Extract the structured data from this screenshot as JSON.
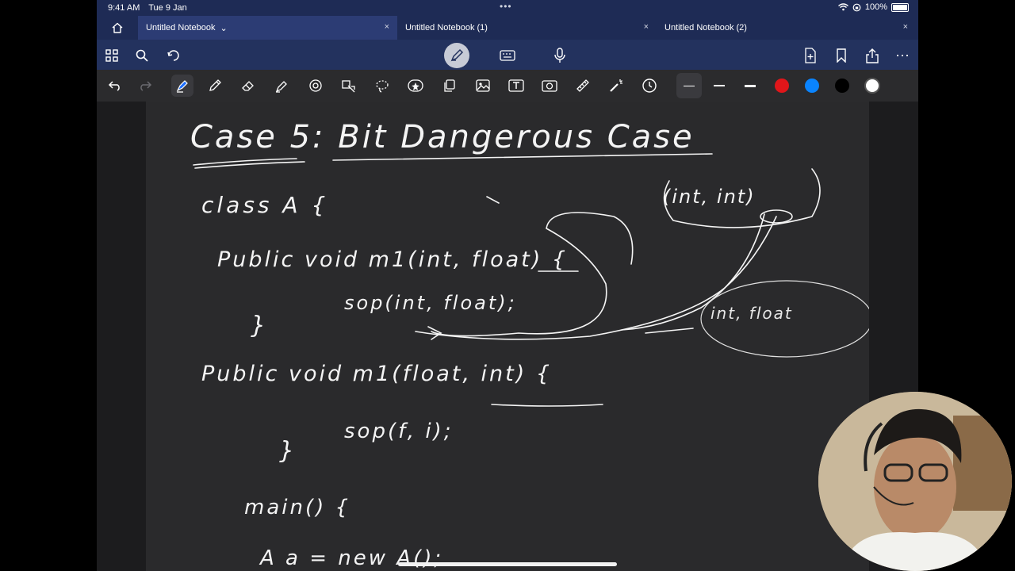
{
  "status_bar": {
    "time": "9:41 AM",
    "date": "Tue 9 Jan",
    "battery": "100%",
    "multitask_dots": "•••"
  },
  "tabs": [
    {
      "title": "Untitled Notebook",
      "active": true,
      "chevron": "⌄",
      "close": "×"
    },
    {
      "title": "Untitled Notebook (1)",
      "active": false,
      "close": "×"
    },
    {
      "title": "Untitled Notebook (2)",
      "active": false,
      "close": "×"
    }
  ],
  "top_toolbar": {
    "left_icons": [
      "grid-icon",
      "search-icon",
      "lasso-sync-icon"
    ],
    "center_icons": [
      "pen-mode-icon",
      "keyboard-icon",
      "microphone-icon"
    ],
    "right_icons": [
      "add-page-icon",
      "bookmark-icon",
      "share-icon",
      "more-icon"
    ],
    "more_label": "⋯"
  },
  "drawing_tools": [
    "undo-icon",
    "redo-icon",
    "fountain-pen-icon",
    "pencil-icon",
    "eraser-icon",
    "highlighter-icon",
    "shape-icon",
    "lasso-icon",
    "lasso-select-icon",
    "sticker-icon",
    "copy-icon",
    "image-icon",
    "text-box-icon",
    "camera-icon",
    "ruler-icon",
    "laser-pointer-icon",
    "timer-icon"
  ],
  "stroke_widths": [
    "thin",
    "medium",
    "thick"
  ],
  "colors": {
    "red": "#e0161a",
    "blue": "#0a84ff",
    "black": "#000000",
    "white": "#ffffff",
    "accent": "#2c3c74"
  },
  "notebook_page": {
    "title": "Case 5: Bit Dangerous Case",
    "lines": [
      "class A {",
      "Public void m1(int, float) {",
      "sop(int, float);",
      "}",
      "Public void m1(float, int) {",
      "sop(f, i);",
      "}",
      "main() {",
      "A a = new A();"
    ],
    "annotations": [
      "(int, int)",
      "int, float"
    ]
  }
}
